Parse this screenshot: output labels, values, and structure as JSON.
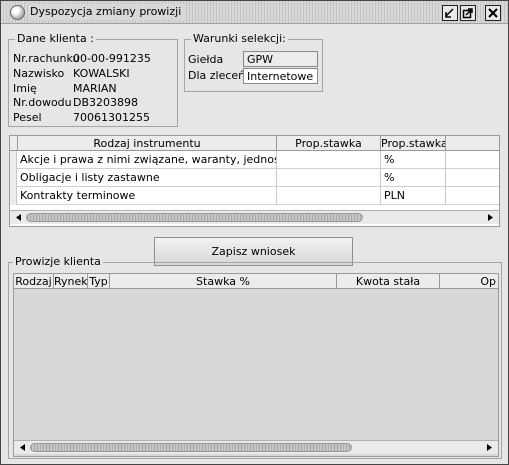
{
  "window": {
    "title": "Dyspozycja zmiany prowizji"
  },
  "client": {
    "legend": "Dane klienta :",
    "rows": [
      {
        "label": "Nr.rachunku",
        "value": "00-00-991235"
      },
      {
        "label": "Nazwisko",
        "value": "KOWALSKI"
      },
      {
        "label": "Imię",
        "value": "MARIAN"
      },
      {
        "label": "Nr.dowodu",
        "value": "DB3203898"
      },
      {
        "label": "Pesel",
        "value": "70061301255"
      }
    ]
  },
  "selection": {
    "legend": "Warunki selekcji:",
    "exchange_label": "Giełda",
    "exchange_value": "GPW",
    "orders_label": "Dla zleceń",
    "orders_value": "Internetowe"
  },
  "instruments": {
    "columns": [
      "Rodzaj instrumentu",
      "Prop.stawka",
      "Prop.stawka"
    ],
    "rows": [
      {
        "name": "Akcje i prawa z nimi związane, waranty, jednostk...",
        "col2": "",
        "col3": "%"
      },
      {
        "name": "Obligacje i listy zastawne",
        "col2": "",
        "col3": "%"
      },
      {
        "name": "Kontrakty terminowe",
        "col2": "",
        "col3": "PLN"
      }
    ]
  },
  "save_button": "Zapisz wniosek",
  "commissions": {
    "legend": "Prowizje klienta",
    "columns": [
      "Rodzaj",
      "Rynek",
      "Typ",
      "Stawka %",
      "Kwota stała",
      "Op"
    ]
  }
}
